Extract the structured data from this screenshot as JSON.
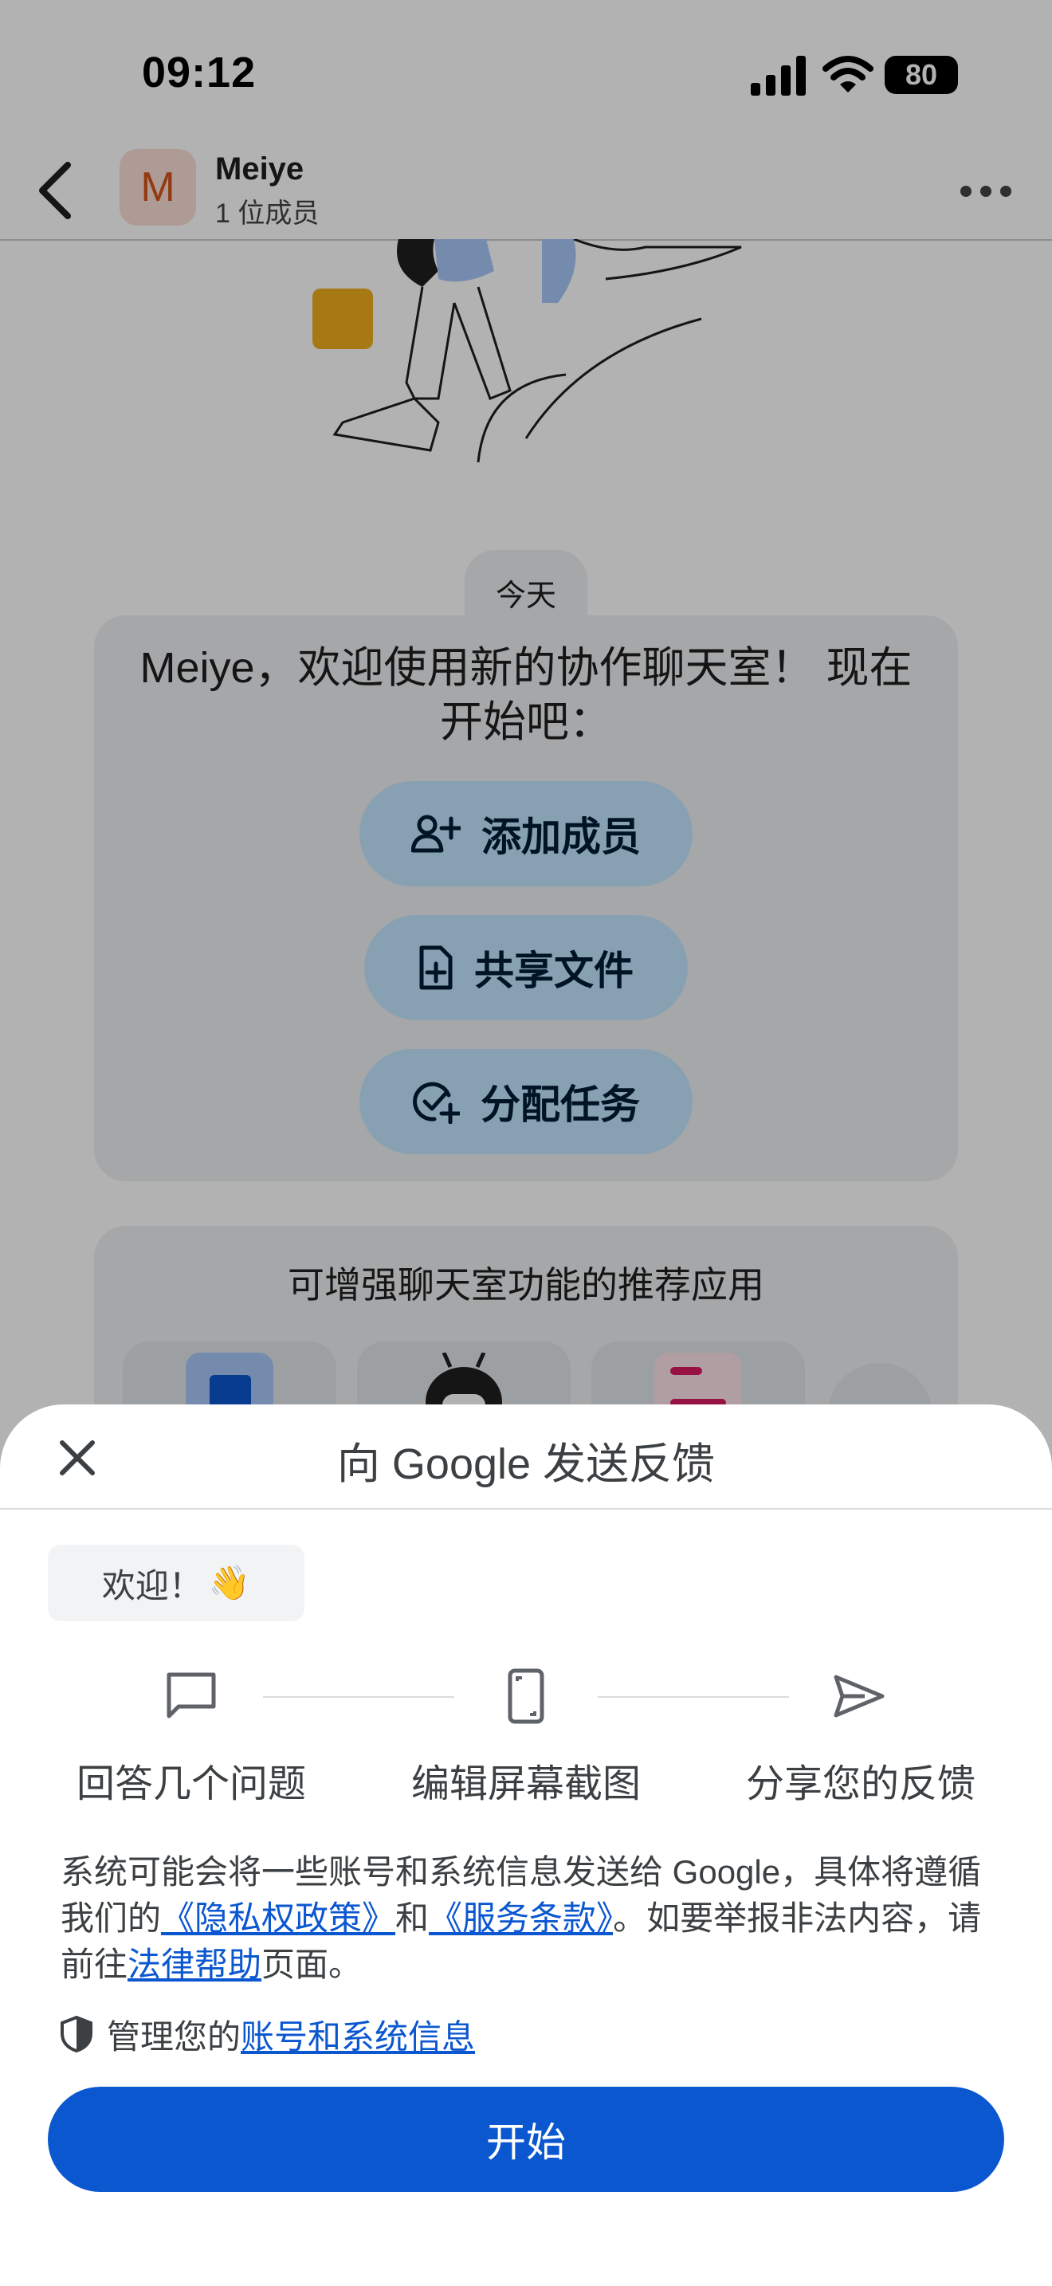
{
  "status_bar": {
    "time": "09:12",
    "battery": "80"
  },
  "header": {
    "avatar_letter": "M",
    "space_name": "Meiye",
    "member_count": "1 位成员"
  },
  "chat": {
    "date_chip": "今天",
    "welcome_message": "Meiye，欢迎使用新的协作聊天室！ 现在开始吧：",
    "actions": [
      {
        "label": "添加成员",
        "icon": "add-person-icon"
      },
      {
        "label": "共享文件",
        "icon": "file-add-icon"
      },
      {
        "label": "分配任务",
        "icon": "task-add-icon"
      }
    ],
    "apps_title": "可增强聊天室功能的推荐应用"
  },
  "sheet": {
    "title": "向 Google 发送反馈",
    "welcome_chip": "欢迎！",
    "welcome_emoji": "👋",
    "steps": [
      {
        "label": "回答几个问题",
        "icon": "chat-bubble-icon"
      },
      {
        "label": "编辑屏幕截图",
        "icon": "screenshot-icon"
      },
      {
        "label": "分享您的反馈",
        "icon": "send-icon"
      }
    ],
    "disclaimer": {
      "part1": "系统可能会将一些账号和系统信息发送给 Google，具体将遵循我们的",
      "privacy_link": "《隐私权政策》",
      "part2": "和",
      "terms_link": "《服务条款》",
      "part3": "。如要举报非法内容，请前往",
      "legal_link": "法律帮助",
      "part4": "页面。"
    },
    "manage_prefix": "管理您的",
    "manage_link": "账号和系统信息",
    "start_button": "开始"
  },
  "colors": {
    "primary": "#0b57d0",
    "pill": "#c2e7ff",
    "card": "#eceff3",
    "avatar_bg": "#f9dfd6",
    "avatar_fg": "#d3541b"
  }
}
